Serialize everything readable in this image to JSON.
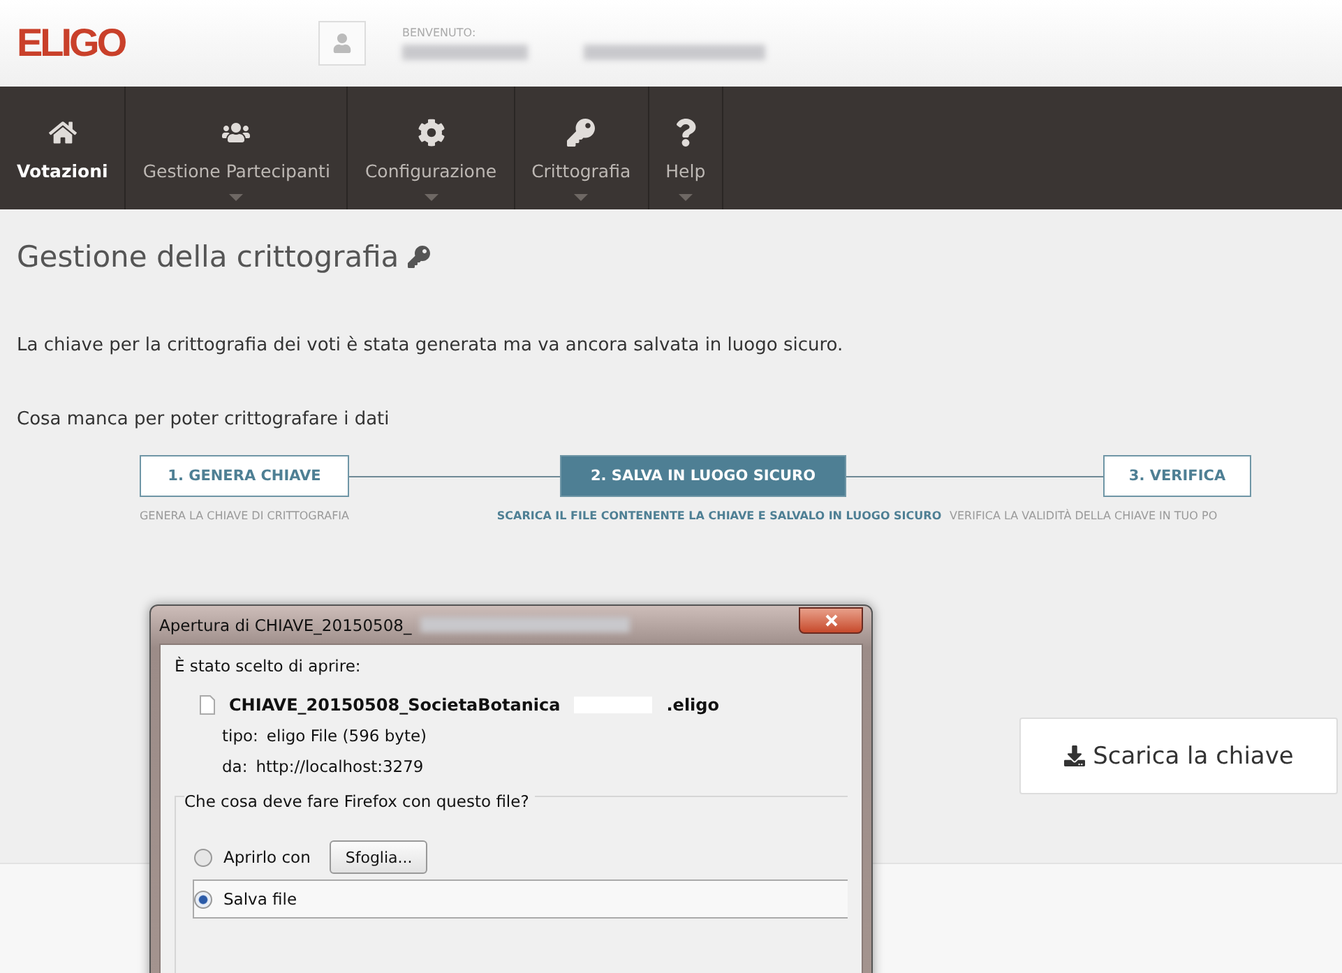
{
  "header": {
    "logo": "ELIGO",
    "welcome_label": "BENVENUTO:"
  },
  "nav": [
    {
      "label": "Votazioni",
      "selected": true,
      "has_menu": false
    },
    {
      "label": "Gestione Partecipanti",
      "selected": false,
      "has_menu": true
    },
    {
      "label": "Configurazione",
      "selected": false,
      "has_menu": true
    },
    {
      "label": "Crittografia",
      "selected": false,
      "has_menu": true
    },
    {
      "label": "Help",
      "selected": false,
      "has_menu": true
    }
  ],
  "page": {
    "title": "Gestione della crittografia",
    "message": "La chiave per la crittografia dei voti è stata generata ma va ancora salvata in luogo sicuro.",
    "steps_heading": "Cosa manca per poter crittografare i dati",
    "steps": [
      {
        "label": "1. GENERA CHIAVE",
        "description": "GENERA LA CHIAVE DI CRITTOGRAFIA",
        "selected": false
      },
      {
        "label": "2. SALVA IN LUOGO SICURO",
        "description": "SCARICA IL FILE CONTENENTE LA CHIAVE E SALVALO IN LUOGO SICURO",
        "selected": true
      },
      {
        "label": "3. VERIFICA",
        "description": "VERIFICA LA VALIDITÀ DELLA CHIAVE IN TUO PO",
        "selected": false
      }
    ],
    "download_button": "Scarica la chiave"
  },
  "dialog": {
    "title": "Apertura di CHIAVE_20150508_",
    "intro": "È stato scelto di aprire:",
    "file_name_start": "CHIAVE_20150508_SocietaBotanica",
    "file_name_end": ".eligo",
    "type_label": "tipo:",
    "type": "eligo File (596 byte)",
    "from_label": "da:",
    "from": "http://localhost:3279",
    "question": "Che cosa deve fare Firefox con questo file?",
    "browse_button": "Sfoglia...",
    "options": [
      {
        "label": "Aprirlo con",
        "selected": false
      },
      {
        "label": "Salva file",
        "selected": true
      }
    ]
  }
}
